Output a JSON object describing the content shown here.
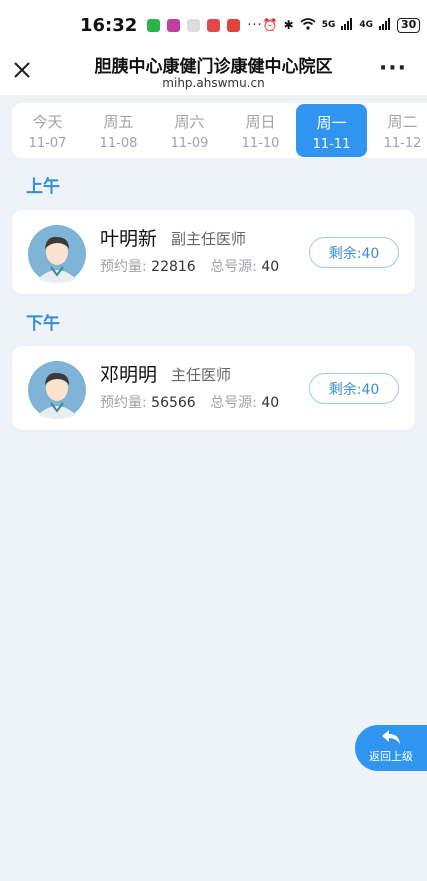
{
  "status": {
    "time": "16:32",
    "battery": "30",
    "signal1": "5G",
    "signal2": "4G"
  },
  "header": {
    "title": "胆胰中心康健门诊康健中心院区",
    "url": "mihp.ahswmu.cn"
  },
  "tabs": [
    {
      "day": "今天",
      "date": "11-07"
    },
    {
      "day": "周五",
      "date": "11-08"
    },
    {
      "day": "周六",
      "date": "11-09"
    },
    {
      "day": "周日",
      "date": "11-10"
    },
    {
      "day": "周一",
      "date": "11-11"
    },
    {
      "day": "周二",
      "date": "11-12"
    }
  ],
  "active_tab_index": 4,
  "sections": [
    {
      "label": "上午",
      "doctor": {
        "name": "叶明新",
        "title": "副主任医师",
        "booked_label": "预约量:",
        "booked": "22816",
        "total_label": "总号源:",
        "total": "40",
        "remain_text": "剩余:40"
      }
    },
    {
      "label": "下午",
      "doctor": {
        "name": "邓明明",
        "title": "主任医师",
        "booked_label": "预约量:",
        "booked": "56566",
        "total_label": "总号源:",
        "total": "40",
        "remain_text": "剩余:40"
      }
    }
  ],
  "back_label": "返回上级",
  "colors": {
    "accent": "#2f95f1",
    "section": "#2e8ed6",
    "bg": "#eef3fa"
  }
}
